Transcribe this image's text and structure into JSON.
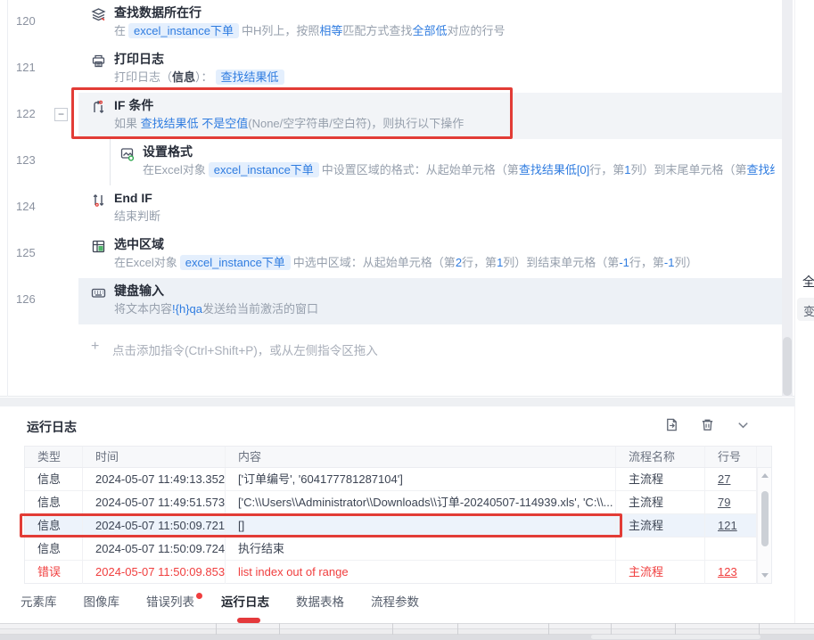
{
  "flow": {
    "rows": [
      {
        "num": "120",
        "icon": "find-data-row-icon",
        "title": "查找数据所在行",
        "selected": false,
        "indent": false,
        "desc": [
          {
            "text": "在",
            "style": "plain"
          },
          {
            "text": "excel_instance下单",
            "style": "chip"
          },
          {
            "text": "中H列上，按照",
            "style": "plain"
          },
          {
            "text": "相等",
            "style": "blue"
          },
          {
            "text": "匹配方式查找",
            "style": "plain"
          },
          {
            "text": "全部低",
            "style": "blue"
          },
          {
            "text": "对应的行号",
            "style": "plain"
          }
        ]
      },
      {
        "num": "121",
        "icon": "printer-icon",
        "title": "打印日志",
        "selected": false,
        "indent": false,
        "desc": [
          {
            "text": "打印日志（",
            "style": "plain"
          },
          {
            "text": "信息",
            "style": "dark"
          },
          {
            "text": "）：",
            "style": "plain"
          },
          {
            "text": "查找结果低",
            "style": "chip"
          }
        ]
      },
      {
        "num": "122",
        "icon": "if-branch-icon",
        "title": "IF 条件",
        "selected": true,
        "indent": false,
        "collapsible": true,
        "desc": [
          {
            "text": "如果 ",
            "style": "plain"
          },
          {
            "text": "查找结果低 不是空值",
            "style": "blue"
          },
          {
            "text": "(None/空字符串/空白符)，则执行以下操作",
            "style": "plain"
          }
        ]
      },
      {
        "num": "123",
        "icon": "format-cells-icon",
        "title": "设置格式",
        "selected": false,
        "indent": true,
        "desc": [
          {
            "text": "在Excel对象",
            "style": "plain"
          },
          {
            "text": "excel_instance下单",
            "style": "chip"
          },
          {
            "text": "中设置区域的格式：从起始单元格（第",
            "style": "plain"
          },
          {
            "text": "查找结果低[0]",
            "style": "blue"
          },
          {
            "text": "行，第",
            "style": "plain"
          },
          {
            "text": "1",
            "style": "blue"
          },
          {
            "text": "列）到末尾单元格（第",
            "style": "plain"
          },
          {
            "text": "查找结...",
            "style": "blue"
          }
        ]
      },
      {
        "num": "124",
        "icon": "end-if-icon",
        "title": "End IF",
        "selected": false,
        "indent": false,
        "desc": [
          {
            "text": "结束判断",
            "style": "plain"
          }
        ]
      },
      {
        "num": "125",
        "icon": "select-range-icon",
        "title": "选中区域",
        "selected": false,
        "indent": false,
        "desc": [
          {
            "text": "在Excel对象",
            "style": "plain"
          },
          {
            "text": "excel_instance下单",
            "style": "chip"
          },
          {
            "text": "中选中区域：从起始单元格（第",
            "style": "plain"
          },
          {
            "text": "2",
            "style": "blue"
          },
          {
            "text": "行，第",
            "style": "plain"
          },
          {
            "text": "1",
            "style": "blue"
          },
          {
            "text": "列）到结束单元格（第",
            "style": "plain"
          },
          {
            "text": "-1",
            "style": "blue"
          },
          {
            "text": "行，第",
            "style": "plain"
          },
          {
            "text": "-1",
            "style": "blue"
          },
          {
            "text": "列）",
            "style": "plain"
          }
        ]
      },
      {
        "num": "126",
        "icon": "keyboard-icon",
        "title": "键盘输入",
        "selected": true,
        "indent": false,
        "desc": [
          {
            "text": "将文本内容",
            "style": "plain"
          },
          {
            "text": "!{h}qa",
            "style": "blue"
          },
          {
            "text": "发送给当前激活的窗口",
            "style": "plain"
          }
        ]
      }
    ],
    "collapse_glyph": "−",
    "add_plus": "+",
    "add_hint": "点击添加指令(Ctrl+Shift+P)，或从左侧指令区拖入"
  },
  "log_panel": {
    "title": "运行日志",
    "columns": [
      "类型",
      "时间",
      "内容",
      "流程名称",
      "行号"
    ],
    "rows": [
      {
        "type": "信息",
        "time": "2024-05-07 11:49:13.352",
        "content": "['订单编号', '604177781287104']",
        "flow": "主流程",
        "line": "27",
        "selected": false,
        "error": false
      },
      {
        "type": "信息",
        "time": "2024-05-07 11:49:51.573",
        "content": "['C:\\\\Users\\\\Administrator\\\\Downloads\\\\订单-20240507-114939.xls', 'C:\\\\...",
        "flow": "主流程",
        "line": "79",
        "selected": false,
        "error": false
      },
      {
        "type": "信息",
        "time": "2024-05-07 11:50:09.721",
        "content": "[]",
        "flow": "主流程",
        "line": "121",
        "selected": true,
        "error": false
      },
      {
        "type": "信息",
        "time": "2024-05-07 11:50:09.724",
        "content": "执行结束",
        "flow": "",
        "line": "",
        "selected": false,
        "error": false
      },
      {
        "type": "错误",
        "time": "2024-05-07 11:50:09.853",
        "content": "list index out of range",
        "flow": "主流程",
        "line": "123",
        "selected": false,
        "error": true
      }
    ]
  },
  "tabs": [
    {
      "label": "元素库",
      "active": false,
      "badge": false
    },
    {
      "label": "图像库",
      "active": false,
      "badge": false
    },
    {
      "label": "错误列表",
      "active": false,
      "badge": true
    },
    {
      "label": "运行日志",
      "active": true,
      "badge": false
    },
    {
      "label": "数据表格",
      "active": false,
      "badge": false
    },
    {
      "label": "流程参数",
      "active": false,
      "badge": false
    }
  ],
  "right_panel": {
    "partial_title": "全",
    "partial_chip": "变"
  },
  "colors": {
    "accent_blue": "#2f7ce0",
    "annotation_red": "#e23c36",
    "error_red": "#f03e3e",
    "tab_indicator_red": "#e4393c"
  }
}
